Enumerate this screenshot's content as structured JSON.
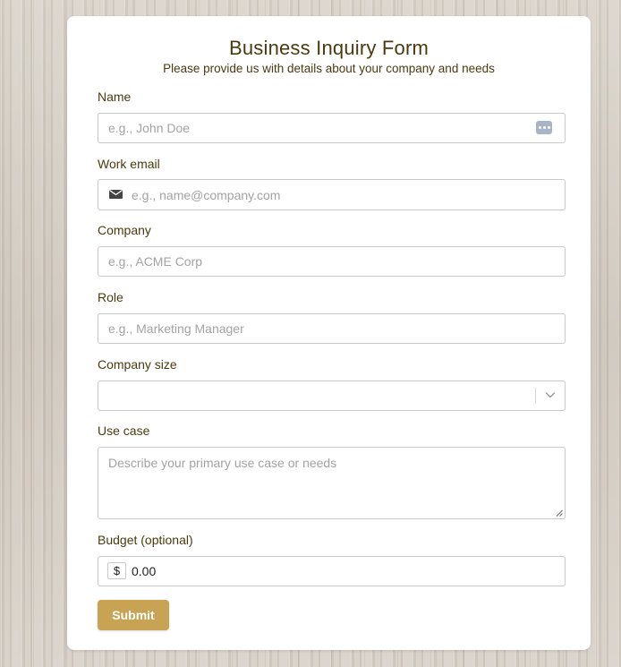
{
  "form": {
    "title": "Business Inquiry Form",
    "subtitle": "Please provide us with details about your company and needs",
    "name": {
      "label": "Name",
      "placeholder": "e.g., John Doe",
      "value": ""
    },
    "email": {
      "label": "Work email",
      "placeholder": "e.g., name@company.com",
      "value": ""
    },
    "company": {
      "label": "Company",
      "placeholder": "e.g., ACME Corp",
      "value": ""
    },
    "role": {
      "label": "Role",
      "placeholder": "e.g., Marketing Manager",
      "value": ""
    },
    "company_size": {
      "label": "Company size",
      "selected": ""
    },
    "use_case": {
      "label": "Use case",
      "placeholder": "Describe your primary use case or needs",
      "value": ""
    },
    "budget": {
      "label": "Budget (optional)",
      "currency_symbol": "$",
      "value": "0.00"
    },
    "submit_label": "Submit"
  },
  "colors": {
    "accent": "#c9a354",
    "text": "#4a3a0f",
    "border": "#c9c9c9"
  },
  "icons": [
    "password-manager-icon",
    "mail-icon",
    "chevron-down-icon",
    "resize-handle-icon"
  ]
}
